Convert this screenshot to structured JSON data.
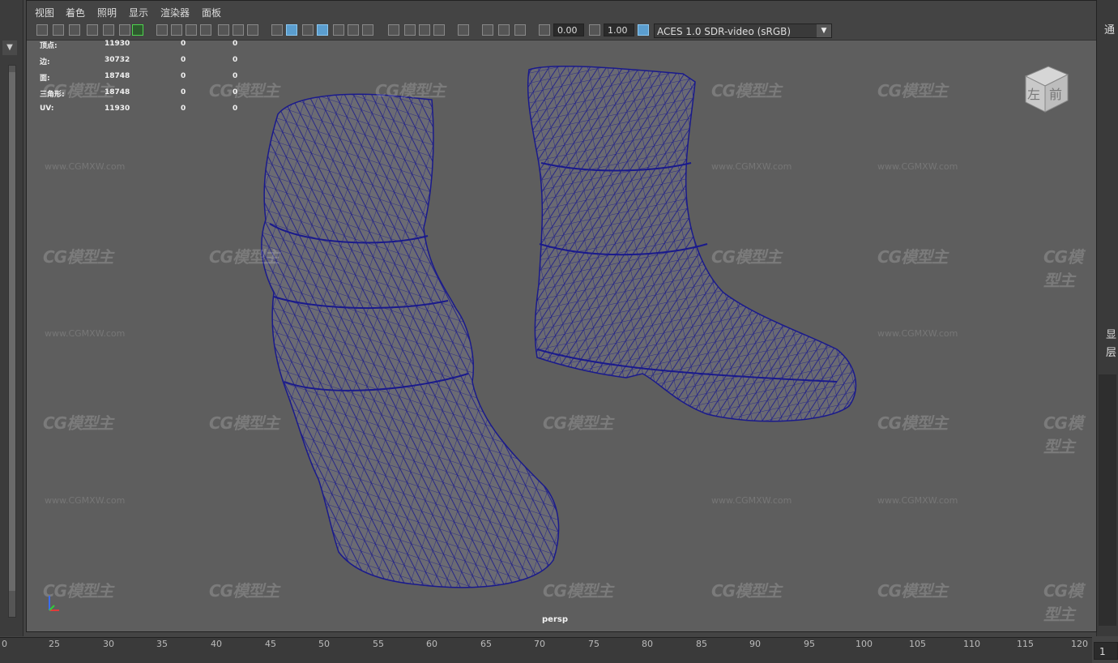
{
  "menu": [
    "视图",
    "着色",
    "照明",
    "显示",
    "渲染器",
    "面板"
  ],
  "toolbar": {
    "exposure_value": "0.00",
    "gamma_value": "1.00",
    "color_space": "ACES 1.0 SDR-video (sRGB)"
  },
  "hud": {
    "rows": [
      {
        "label": "顶点:",
        "v1": "11930",
        "v2": "0",
        "v3": "0"
      },
      {
        "label": "边:",
        "v1": "30732",
        "v2": "0",
        "v3": "0"
      },
      {
        "label": "面:",
        "v1": "18748",
        "v2": "0",
        "v3": "0"
      },
      {
        "label": "三角形:",
        "v1": "18748",
        "v2": "0",
        "v3": "0"
      },
      {
        "label": "UV:",
        "v1": "11930",
        "v2": "0",
        "v3": "0"
      }
    ]
  },
  "viewcube": {
    "left": "左",
    "front": "前"
  },
  "camera_label": "persp",
  "watermark": {
    "logo": "CG模型主",
    "url": "www.CGMXW.com"
  },
  "right_panel": {
    "label1": "通",
    "label2": "显",
    "label3": "层"
  },
  "timeline": {
    "ticks": [
      "0",
      "25",
      "30",
      "35",
      "40",
      "45",
      "50",
      "55",
      "60",
      "65",
      "70",
      "75",
      "80",
      "85",
      "90",
      "95",
      "100",
      "105",
      "110",
      "115",
      "120"
    ],
    "current_frame": "1"
  },
  "colors": {
    "wireframe": "#1a1a8c",
    "viewport_bg": "#5e5e5e",
    "accent": "#5b9ecf"
  }
}
